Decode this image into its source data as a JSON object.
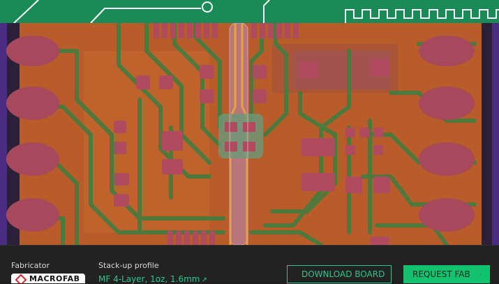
{
  "colors": {
    "banner": "#1a8a57",
    "board_background": "#2a2038",
    "copper": "#c2662a",
    "pad": "#b14a5c",
    "trace": "#4f7a3a",
    "accent": "#2fc58a",
    "primary_button": "#12c26f"
  },
  "footer": {
    "fabricator_label": "Fabricator",
    "fabricator_logo_text": "MACROFAB",
    "stackup_label": "Stack-up profile",
    "stackup_value": "MF 4-Layer, 1oz, 1.6mm",
    "download_button": "DOWNLOAD BOARD",
    "request_button": "REQUEST FAB"
  },
  "icons": {
    "download": "download-icon",
    "external_link": "external-link-icon",
    "chevron": "chevron-right-icon",
    "logo": "macrofab-logo-icon"
  }
}
